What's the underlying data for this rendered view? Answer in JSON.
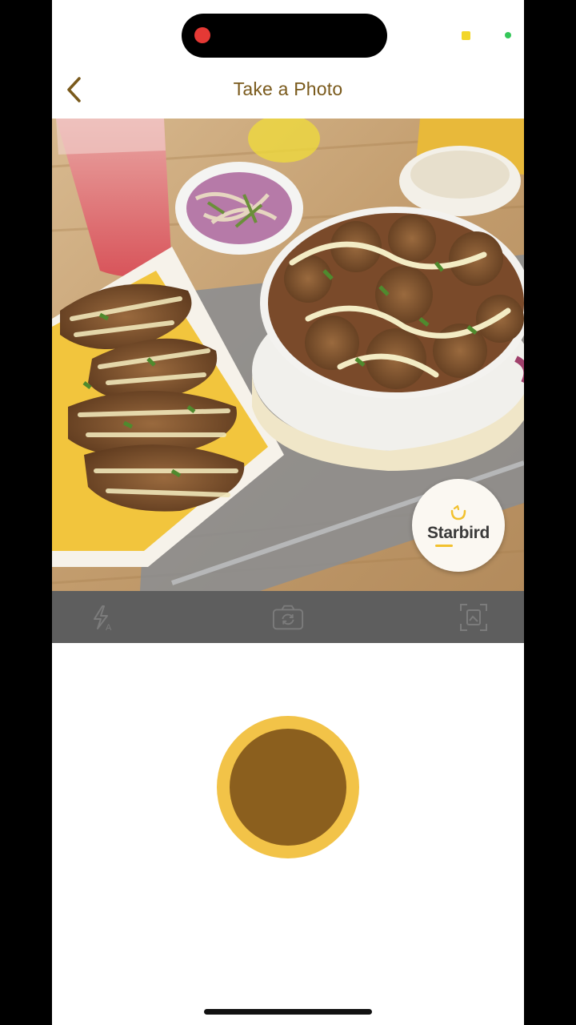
{
  "status_bar": {
    "recording_dot_color": "#e53935",
    "indicator_yellow": "#f2d62a",
    "indicator_green": "#34c759"
  },
  "header": {
    "back_icon": "chevron-left-icon",
    "title": "Take a Photo"
  },
  "photo": {
    "badge_logo_icon": "starbird-smile-icon",
    "badge_text": "Starbird"
  },
  "camera_toolbar": {
    "flash_icon": "flash-auto-icon",
    "switch_camera_icon": "camera-switch-icon",
    "gallery_icon": "gallery-icon"
  },
  "shutter": {
    "outer_color": "#f2c348",
    "inner_color": "#8b5f1e"
  },
  "colors": {
    "accent": "#7a5a1c",
    "toolbar": "#5e5e5e"
  }
}
